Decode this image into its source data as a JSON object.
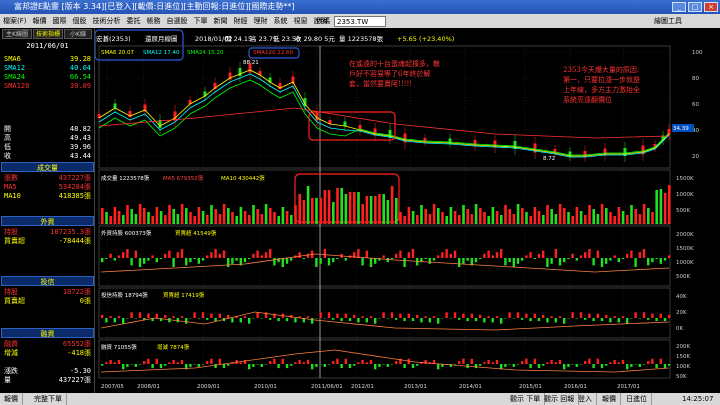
{
  "window": {
    "title": "富邦證E點靈 [版本 3.34][已登入][載價:日進位][主動回報:日進位][國際走勢**]",
    "controls": [
      "_",
      "□",
      "×"
    ]
  },
  "menubar": {
    "items": [
      "檔案(F)",
      "報價",
      "國際",
      "個股",
      "技術分析",
      "委託",
      "帳務",
      "自選股",
      "下單",
      "新聞",
      "財經",
      "理財",
      "系統",
      "視窗",
      "說明"
    ],
    "code_label": "代碼",
    "code_value": "2353.TW",
    "tools_label": "繪圖工具"
  },
  "leftpanel": {
    "tabs": [
      "主K線圖",
      "技術指標",
      "小K線"
    ],
    "date": "2011/06/01",
    "ma_rows": [
      {
        "label": "SMA6",
        "value": "39.28",
        "color": "#ffff00"
      },
      {
        "label": "SMA12",
        "value": "40.04",
        "color": "#00ffff"
      },
      {
        "label": "SMA24",
        "value": "66.54",
        "color": "#00ff00"
      },
      {
        "label": "SMA120",
        "value": "39.09",
        "color": "#ff3030"
      }
    ],
    "ohlc_rows": [
      {
        "label": "開",
        "value": "48.82"
      },
      {
        "label": "高",
        "value": "49.43"
      },
      {
        "label": "低",
        "value": "39.96"
      },
      {
        "label": "收",
        "value": "43.44"
      }
    ],
    "volume_section": {
      "title": "成交量",
      "rows": [
        {
          "label": "張數",
          "value": "437227張",
          "color": "#ff3030"
        },
        {
          "label": "MA5",
          "value": "534284張",
          "color": "#ff3030"
        },
        {
          "label": "MA10",
          "value": "418385張",
          "color": "#ffff00"
        }
      ]
    },
    "foreign_section": {
      "title": "外資",
      "rows": [
        {
          "label": "持股",
          "value": "107235.3張",
          "color": "#ff3030"
        },
        {
          "label": "買賣超",
          "value": "-78444張",
          "color": "#ffff00"
        }
      ]
    },
    "trust_section": {
      "title": "投信",
      "rows": [
        {
          "label": "持股",
          "value": "10722張",
          "color": "#ff3030"
        },
        {
          "label": "買賣超",
          "value": "0張",
          "color": "#ffff00"
        }
      ]
    },
    "margin_section": {
      "title": "融資",
      "rows": [
        {
          "label": "融資",
          "value": "65552張",
          "color": "#ff3030"
        },
        {
          "label": "增減",
          "value": "-418張",
          "color": "#ffff00"
        }
      ]
    },
    "bottom_rows": [
      {
        "label": "漲跌",
        "value": "-5.30"
      },
      {
        "label": "量",
        "value": "437227張"
      }
    ]
  },
  "chart_header": {
    "stock": "宏碁(2353)",
    "period": "還原月線圖",
    "date": "2018/01/02",
    "open": "開 24.15",
    "high": "高 23.75",
    "low": "低 23.50",
    "close": "收 29.80 5元",
    "volume": "量 1223578張",
    "change": "+5.65 (+23.40%)"
  },
  "ma_legend": [
    {
      "text": "SMA6 20.07",
      "color": "#ffff00"
    },
    {
      "text": "SMA12 17.40",
      "color": "#00ffff"
    },
    {
      "text": "SMA24 15.20",
      "color": "#00ff00"
    },
    {
      "text": "SMA120 22.60",
      "color": "#ff3030"
    }
  ],
  "price_labels": {
    "peak": "88.21",
    "trough": "8.72",
    "last": "34.39"
  },
  "price_axis": [
    "100",
    "80",
    "60",
    "40",
    "20"
  ],
  "volume_legend": {
    "vol": "成交量 1223578張",
    "ma5": "MA5 679352張",
    "ma10": "MA10 430442張"
  },
  "volume_axis": [
    "1500K",
    "1000K",
    "500K"
  ],
  "foreign_legend": {
    "a": "外資持股 600373張",
    "b": "買賣超 41549張"
  },
  "foreign_axis": [
    "2000K",
    "1500K",
    "1000K",
    "500K"
  ],
  "trust_legend": {
    "a": "投信持股 18794張",
    "b": "買賣超 17419張"
  },
  "trust_axis": [
    "40K",
    "20K",
    "0K"
  ],
  "margin_legend": {
    "a": "融資 71055張",
    "b": "增減 7874張"
  },
  "margin_axis": [
    "200K",
    "150K",
    "100K",
    "50K"
  ],
  "x_axis": [
    "2007/05",
    "2008/01",
    "2009/01",
    "2010/01",
    "2011/06/01",
    "2012/01",
    "2013/01",
    "2014/01",
    "2015/01",
    "2016/01",
    "2017/01"
  ],
  "annotation_left": {
    "lines": [
      "在遙遠的十台蛋魂起撞多，散",
      "戶好不容易等了6年終於解",
      "套，當然要賣阿!!!!!"
    ]
  },
  "annotation_right": {
    "lines": [
      "2353今天爆大量的原因:",
      "第一，只要拉漲一步就是",
      "上年線，多方主力激抬全",
      "系統亮遠翻價位"
    ]
  },
  "statusbar": {
    "left_items": [
      "報價",
      "完整下單"
    ],
    "right_items": [
      "觀示 下單",
      "觀示 回報",
      "登入",
      "報價",
      "日進位"
    ],
    "time": "14:25:07"
  },
  "colors": {
    "up": "#ff2020",
    "down": "#20e020",
    "bg": "#000000",
    "grid": "#404040",
    "ma6": "#ffff00",
    "ma12": "#00ffff",
    "ma24": "#00ff00",
    "ma120": "#ff3030",
    "highlight_box": "#ff2020",
    "blue_box": "#2a5bd8"
  }
}
